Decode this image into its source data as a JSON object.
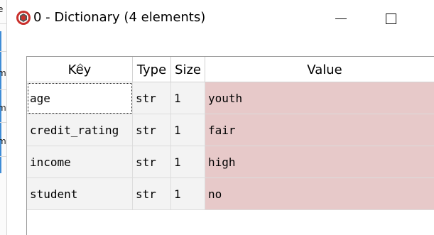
{
  "window": {
    "title": "0 - Dictionary (4 elements)",
    "icon": "spyder-variable-icon"
  },
  "background_window": {
    "fragments": [
      "e",
      "m",
      "m",
      "m"
    ]
  },
  "table": {
    "columns": [
      "Key",
      "Type",
      "Size",
      "Value"
    ],
    "sorted_column": "Key",
    "rows": [
      {
        "key": "age",
        "type": "str",
        "size": "1",
        "value": "youth"
      },
      {
        "key": "credit_rating",
        "type": "str",
        "size": "1",
        "value": "fair"
      },
      {
        "key": "income",
        "type": "str",
        "size": "1",
        "value": "high"
      },
      {
        "key": "student",
        "type": "str",
        "size": "1",
        "value": "no"
      }
    ],
    "value_cell_color": "#e7c9c9",
    "cell_color": "#f3f3f3"
  }
}
